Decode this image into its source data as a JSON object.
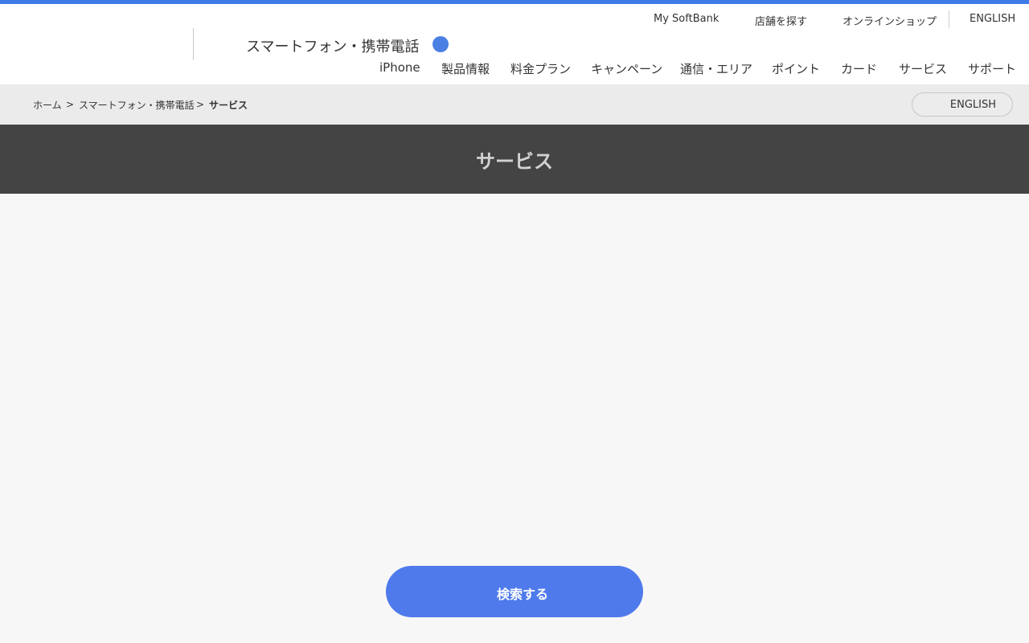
{
  "header": {
    "site_title": "スマートフォン・携帯電話",
    "utility_links": [
      "My SoftBank",
      "店舗を探す",
      "オンラインショップ",
      "ENGLISH"
    ],
    "nav": [
      "iPhone",
      "製品情報",
      "料金プラン",
      "キャンペーン",
      "通信・エリア",
      "ポイント",
      "カード",
      "サービス",
      "サポート"
    ]
  },
  "breadcrumb": {
    "items": [
      "ホーム",
      "スマートフォン・携帯電話",
      "サービス"
    ],
    "separator": ">"
  },
  "language_button": "ENGLISH",
  "page": {
    "title": "サービス"
  },
  "search_button": "検索する",
  "colors": {
    "accent": "#3f7be8",
    "button": "#4f7aec",
    "hero_bg": "#444444"
  }
}
